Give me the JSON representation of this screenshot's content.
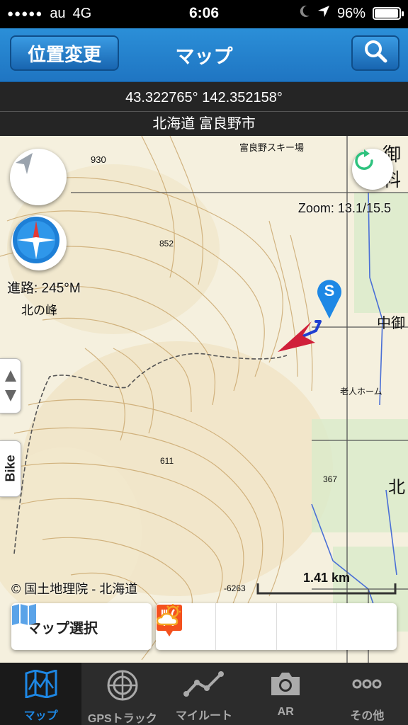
{
  "status": {
    "signal_dots": "●●●●●",
    "carrier": "au",
    "network": "4G",
    "time": "6:06",
    "battery_percent": "96%",
    "battery_level": 0.96,
    "moon_icon": "moon-icon",
    "location_icon": "location-arrow-icon"
  },
  "nav": {
    "left_button": "位置変更",
    "title": "マップ",
    "right_icon": "search-icon"
  },
  "coords": {
    "latlon": "43.322765° 142.352158°",
    "place": "北海道 富良野市"
  },
  "map": {
    "zoom": "Zoom: 13.1/15.5",
    "heading": "進路: 245°M",
    "attribution": "© 国土地理院 - 北海道",
    "scale": "1.41 km",
    "bike_label": "Bike",
    "marker_label": "S",
    "labels": {
      "peak": "北の峰",
      "ski": "富良野スキー場",
      "elev_930": "930",
      "elev_852": "852",
      "elev_611": "611",
      "elev_367": "367",
      "elev_6263": "-6263",
      "kanji_1": "御",
      "kanji_2": "料",
      "kanji_3": "中御",
      "kanji_4": "北",
      "place_2": "老人ホーム"
    },
    "accent_track": "#1f3fd1",
    "accent_arrow": "#d0203a",
    "marker_color": "#1e88e5"
  },
  "toolbar": {
    "map_select": "マップ選択",
    "icons": [
      "save-icon",
      "add-icon",
      "restaurant-icon",
      "weather-icon"
    ]
  },
  "tabs": [
    {
      "label": "マップ",
      "icon": "map-icon",
      "active": true
    },
    {
      "label": "GPSトラック",
      "icon": "radar-icon",
      "active": false
    },
    {
      "label": "マイルート",
      "icon": "route-icon",
      "active": false
    },
    {
      "label": "AR",
      "icon": "camera-icon",
      "active": false
    },
    {
      "label": "その他",
      "icon": "more-icon",
      "active": false
    }
  ]
}
